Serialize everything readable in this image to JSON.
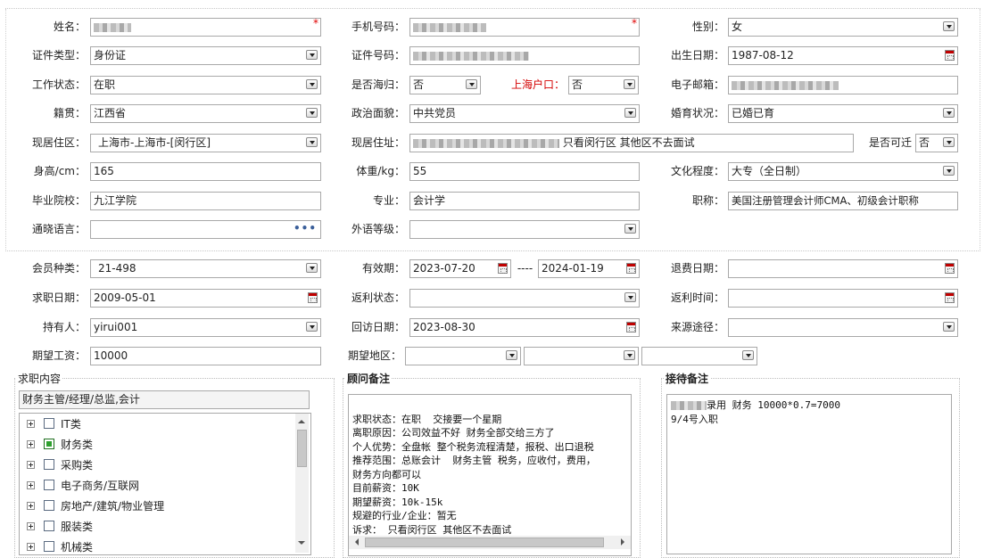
{
  "form": {
    "name": {
      "label": "姓名：",
      "value": ""
    },
    "phone": {
      "label": "手机号码：",
      "value": ""
    },
    "gender": {
      "label": "性别：",
      "value": "女"
    },
    "id_type": {
      "label": "证件类型：",
      "value": "身份证"
    },
    "id_number": {
      "label": "证件号码：",
      "value": ""
    },
    "birth_date": {
      "label": "出生日期：",
      "value": "1987-08-12"
    },
    "work_status": {
      "label": "工作状态：",
      "value": "在职"
    },
    "overseas": {
      "label": "是否海归：",
      "value": "否"
    },
    "shanghai_hukou": {
      "label": "上海户口：",
      "value": "否"
    },
    "email": {
      "label": "电子邮箱：",
      "value": ""
    },
    "native_place": {
      "label": "籍贯：",
      "value": "江西省"
    },
    "political": {
      "label": "政治面貌：",
      "value": "中共党员"
    },
    "marital": {
      "label": "婚育状况：",
      "value": "已婚已育"
    },
    "current_area": {
      "label": "现居住区：",
      "value": "上海市-上海市-[闵行区]"
    },
    "current_address": {
      "label": "现居住址：",
      "value_suffix": "只看闵行区 其他区不去面试"
    },
    "relocate": {
      "label": "是否可迁",
      "value": "否"
    },
    "height": {
      "label": "身高/cm：",
      "value": "165"
    },
    "weight": {
      "label": "体重/kg：",
      "value": "55"
    },
    "education": {
      "label": "文化程度：",
      "value": "大专（全日制）"
    },
    "school": {
      "label": "毕业院校：",
      "value": "九江学院"
    },
    "major": {
      "label": "专业：",
      "value": "会计学"
    },
    "title": {
      "label": "职称：",
      "value": "美国注册管理会计师CMA、初级会计职称"
    },
    "languages": {
      "label": "通晓语言：",
      "value": "",
      "button": "•••"
    },
    "language_level": {
      "label": "外语等级：",
      "value": ""
    },
    "member_type": {
      "label": "会员种类：",
      "value": "21-498"
    },
    "valid_period": {
      "label": "有效期：",
      "start": "2023-07-20",
      "sep": "----",
      "end": "2024-01-19"
    },
    "refund_date": {
      "label": "退费日期：",
      "value": ""
    },
    "apply_date": {
      "label": "求职日期：",
      "value": "2009-05-01"
    },
    "rebate_status": {
      "label": "返利状态：",
      "value": ""
    },
    "rebate_time": {
      "label": "返利时间：",
      "value": ""
    },
    "holder": {
      "label": "持有人：",
      "value": "yirui001"
    },
    "visit_date": {
      "label": "回访日期：",
      "value": "2023-08-30"
    },
    "source": {
      "label": "来源途径：",
      "value": ""
    },
    "expected_salary": {
      "label": "期望工资：",
      "value": "10000"
    },
    "expected_region": {
      "label": "期望地区：",
      "values": [
        "",
        "",
        ""
      ]
    }
  },
  "job_content": {
    "title": "求职内容",
    "selected": "财务主管/经理/总监,会计",
    "tree": [
      {
        "label": "IT类",
        "checked": false
      },
      {
        "label": "财务类",
        "checked": true
      },
      {
        "label": "采购类",
        "checked": false
      },
      {
        "label": "电子商务/互联网",
        "checked": false
      },
      {
        "label": "房地产/建筑/物业管理",
        "checked": false
      },
      {
        "label": "服装类",
        "checked": false
      },
      {
        "label": "机械类",
        "checked": false
      }
    ]
  },
  "consultant_notes": {
    "title": "顾问备注",
    "lines": [
      "求职状态：在职  交接要一个星期",
      "离职原因：公司效益不好 财务全部交给三方了",
      "个人优势：全盘帐 整个税务流程清楚，报税、出口退税",
      "推荐范围：总账会计  财务主管 税务，应收付，费用，",
      "财务方向都可以",
      "目前薪资：10K",
      "期望薪资：10k-15k",
      "规避的行业/企业：暂无",
      "诉求： 只看闵行区 其他区不去面试"
    ]
  },
  "reception_notes": {
    "title": "接待备注",
    "lines": [
      "录用  财务 10000*0.7=7000",
      "9/4号入职"
    ]
  }
}
